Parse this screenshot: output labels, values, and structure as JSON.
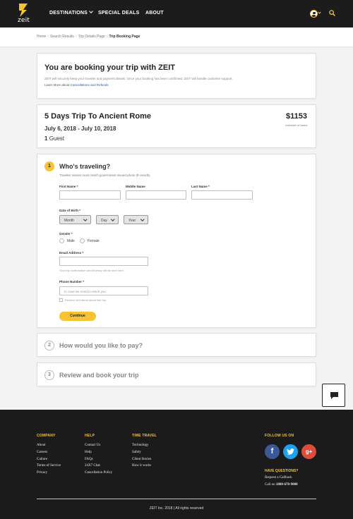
{
  "header": {
    "logo_text": "zeit",
    "nav": [
      "DESTINATIONS",
      "SPECIAL DEALS",
      "ABOUT"
    ]
  },
  "breadcrumb": [
    "Home",
    "Search Results",
    "Trip Details Page",
    "Trip Booking Page"
  ],
  "intro": {
    "heading": "You are booking your trip with ZEIT",
    "body": "ZEIT will securely keep your traveler and payment details. Once your booking has been confirmed, ZEIT will handle customer support.",
    "learn_prefix": "Learn More about",
    "learn_link": "Cancellations and Refunds"
  },
  "trip": {
    "title": "5 Days Trip To Ancient Rome",
    "dates": "July 6, 2018 - July 10, 2018",
    "guest_count": "1",
    "guest_label": "Guest",
    "price": "$1153",
    "price_note": "Inclusive of taxes"
  },
  "travelers": {
    "step": "1",
    "title": "Who's traveling?",
    "note": "Traveler names must match government issued photo ID exactly.",
    "first_name_label": "First Name *",
    "middle_name_label": "Middle Name",
    "last_name_label": "Last Name *",
    "dob_label": "Date of Birth *",
    "month": "Month",
    "day": "Day",
    "year": "Year",
    "gender_label": "Gender *",
    "male": "Male",
    "female": "Female",
    "email_label": "Email Address *",
    "email_hint": "Your trip confirmation and itinerary will be sent here.",
    "phone_label": "Phone Number *",
    "phone_placeholder": "In case we need to reach you",
    "text_alerts": "Receive text alerts about this trip.",
    "continue": "Continue"
  },
  "payment": {
    "step": "2",
    "title": "How would you like to pay?"
  },
  "review": {
    "step": "3",
    "title": "Review and book your trip"
  },
  "footer": {
    "company": {
      "heading": "COMPANY",
      "links": [
        "About",
        "Careers",
        "Culture",
        "Terms of Service",
        "Privacy"
      ]
    },
    "help": {
      "heading": "HELP",
      "links": [
        "Contact Us",
        "Help",
        "FAQs",
        "24X7 Chat",
        "Cancellation Policy"
      ]
    },
    "time_travel": {
      "heading": "TIME TRAVEL",
      "links": [
        "Technology",
        "Safety",
        "Client Stories",
        "How it works"
      ]
    },
    "follow_heading": "FOLLOW US ON",
    "social": [
      "facebook-icon",
      "twitter-icon",
      "google-plus-icon"
    ],
    "questions_heading": "HAVE QUESTIONS?",
    "callback": "Request a Callback",
    "call_prefix": "Call on",
    "phone": "1800-678-9000",
    "copyright": "ZEIT Inc. 2018 | All rights reserved"
  },
  "colors": {
    "accent": "#f7c332",
    "dark": "#1c1c1c",
    "link": "#1a5bbf"
  }
}
